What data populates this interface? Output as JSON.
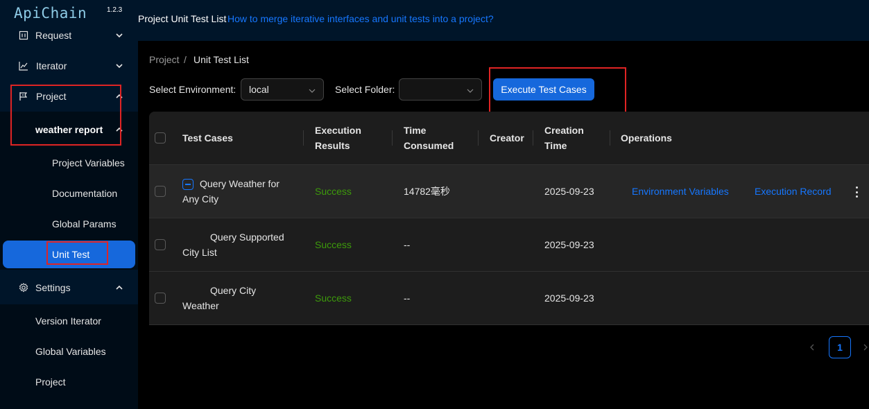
{
  "app": {
    "logo": "ApiChain",
    "version": "1.2.3"
  },
  "sidebar": {
    "items": [
      {
        "label": "Request",
        "icon": "request-icon"
      },
      {
        "label": "Iterator",
        "icon": "chart-line-icon"
      },
      {
        "label": "Project",
        "icon": "flag-icon"
      },
      {
        "label": "weather report"
      },
      {
        "label": "Project Variables"
      },
      {
        "label": "Documentation"
      },
      {
        "label": "Global Params"
      },
      {
        "label": "Unit Test"
      },
      {
        "label": "Settings",
        "icon": "gear-icon"
      },
      {
        "label": "Version Iterator"
      },
      {
        "label": "Global Variables"
      },
      {
        "label": "Project"
      }
    ]
  },
  "header": {
    "title": "Project Unit Test List",
    "help_link": "How to merge iterative interfaces and unit tests into a project?"
  },
  "breadcrumb": {
    "parent": "Project",
    "separator": "/",
    "current": "Unit Test List"
  },
  "filters": {
    "environment_label": "Select Environment:",
    "environment_value": "local",
    "folder_label": "Select Folder:",
    "folder_value": ""
  },
  "actions": {
    "execute_label": "Execute Test Cases"
  },
  "table": {
    "headers": {
      "test_cases": "Test Cases",
      "results_1": "Execution",
      "results_2": "Results",
      "time_1": "Time",
      "time_2": "Consumed",
      "creator": "Creator",
      "creation_1": "Creation",
      "creation_2": "Time",
      "operations": "Operations"
    },
    "rows": [
      {
        "name_1": "Query Weather for",
        "name_2": "Any City",
        "result": "Success",
        "time": "14782毫秒",
        "creator": "",
        "created": "2025-09-23",
        "op_env": "Environment Variables",
        "op_record": "Execution Record"
      },
      {
        "name_1": "Query Supported",
        "name_2": "City List",
        "result": "Success",
        "time": "--",
        "creator": "",
        "created": "2025-09-23"
      },
      {
        "name_1": "Query City",
        "name_2": "Weather",
        "result": "Success",
        "time": "--",
        "creator": "",
        "created": "2025-09-23"
      }
    ]
  },
  "pagination": {
    "current_page": "1"
  },
  "colors": {
    "primary": "#1668dc",
    "link": "#1677ff",
    "success": "#3d9b0b",
    "sidebar_bg": "#001529",
    "highlight_box": "#e02424"
  }
}
